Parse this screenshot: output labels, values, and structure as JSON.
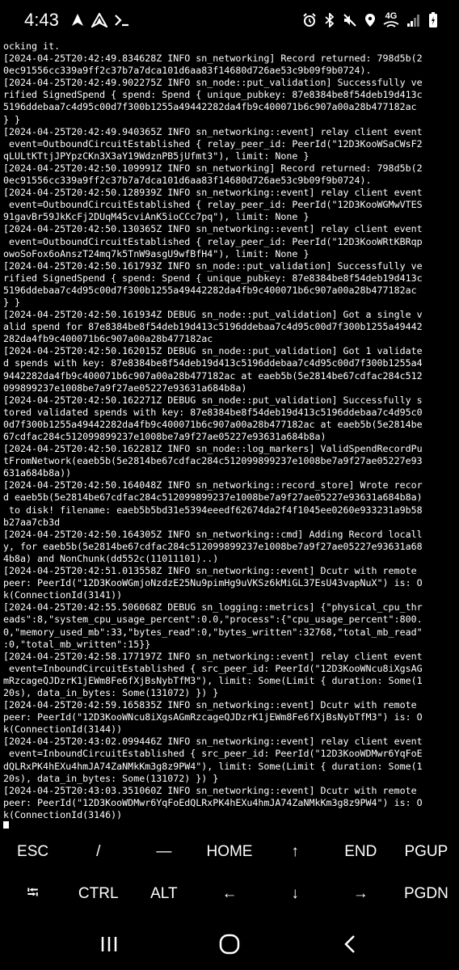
{
  "status_bar": {
    "time": "4:43",
    "network_label": "4G"
  },
  "terminal": {
    "lines": [
      "ocking it.",
      "[2024-04-25T20:42:49.834628Z INFO sn_networking] Record returned: 798d5b(2",
      "0ec91556cc339a9ff2c37b7a7dca101d6aa83f14680d726ae53c9b09f9b0724).",
      "[2024-04-25T20:42:49.902275Z INFO sn_node::put_validation] Successfully ve",
      "rified SignedSpend { spend: Spend { unique_pubkey: 87e8384be8f54deb19d413c",
      "5196ddebaa7c4d95c00d7f300b1255a49442282da4fb9c400071b6c907a00a28b477182ac",
      "} }",
      "[2024-04-25T20:42:49.940365Z INFO sn_networking::event] relay client event",
      " event=OutboundCircuitEstablished { relay_peer_id: PeerId(\"12D3KooWSaCWsF2",
      "qLULtKTtjJPYpzCKn3X3aY19WdznPB5jUfmt3\"), limit: None }",
      "[2024-04-25T20:42:50.109991Z INFO sn_networking] Record returned: 798d5b(2",
      "0ec91556cc339a9ff2c37b7a7dca101d6aa83f14680d726ae53c9b09f9b0724).",
      "[2024-04-25T20:42:50.128939Z INFO sn_networking::event] relay client event",
      " event=OutboundCircuitEstablished { relay_peer_id: PeerId(\"12D3KooWGMwVTES",
      "91gavBr59JkKcFj2DUqM45cviAnK5ioCCc7pq\"), limit: None }",
      "[2024-04-25T20:42:50.130365Z INFO sn_networking::event] relay client event",
      " event=OutboundCircuitEstablished { relay_peer_id: PeerId(\"12D3KooWRtKBRqp",
      "owoSoFox6oAnszT24mq7k5TnW9asgU9wfBfH4\"), limit: None }",
      "[2024-04-25T20:42:50.161793Z INFO sn_node::put_validation] Successfully ve",
      "rified SignedSpend { spend: Spend { unique_pubkey: 87e8384be8f54deb19d413c",
      "5196ddebaa7c4d95c00d7f300b1255a49442282da4fb9c400071b6c907a00a28b477182ac",
      "} }",
      "[2024-04-25T20:42:50.161934Z DEBUG sn_node::put_validation] Got a single v",
      "alid spend for 87e8384be8f54deb19d413c5196ddebaa7c4d95c00d7f300b1255a49442",
      "282da4fb9c400071b6c907a00a28b477182ac",
      "[2024-04-25T20:42:50.162015Z DEBUG sn_node::put_validation] Got 1 validate",
      "d spends with key: 87e8384be8f54deb19d413c5196ddebaa7c4d95c00d7f300b1255a4",
      "9442282da4fb9c400071b6c907a00a28b477182ac at eaeb5b(5e2814be67cdfac284c512",
      "099899237e1008be7a9f27ae05227e93631a684b8a)",
      "[2024-04-25T20:42:50.162271Z DEBUG sn_node::put_validation] Successfully s",
      "tored validated spends with key: 87e8384be8f54deb19d413c5196ddebaa7c4d95c0",
      "0d7f300b1255a49442282da4fb9c400071b6c907a00a28b477182ac at eaeb5b(5e2814be",
      "67cdfac284c512099899237e1008be7a9f27ae05227e93631a684b8a)",
      "[2024-04-25T20:42:50.162281Z INFO sn_node::log_markers] ValidSpendRecordPu",
      "tFromNetwork(eaeb5b(5e2814be67cdfac284c512099899237e1008be7a9f27ae05227e93",
      "631a684b8a))",
      "[2024-04-25T20:42:50.164048Z INFO sn_networking::record_store] Wrote recor",
      "d eaeb5b(5e2814be67cdfac284c512099899237e1008be7a9f27ae05227e93631a684b8a)",
      " to disk! filename: eaeb5b5bd31e5394eeedf62674da2f4f1045ee0260e933231a9b58",
      "b27aa7cb3d",
      "[2024-04-25T20:42:50.164305Z INFO sn_networking::cmd] Adding Record locall",
      "y, for eaeb5b(5e2814be67cdfac284c512099899237e1008be7a9f27ae05227e93631a68",
      "4b8a) and NonChunk(dd552c(11011101)..)",
      "[2024-04-25T20:42:51.013558Z INFO sn_networking::event] Dcutr with remote",
      "peer: PeerId(\"12D3KooWGmjoNzdzE25Nu9pimHg9uVKSz6kMiGL37EsU43vapNuX\") is: O",
      "k(ConnectionId(3141))",
      "[2024-04-25T20:42:55.506068Z DEBUG sn_logging::metrics] {\"physical_cpu_thr",
      "eads\":8,\"system_cpu_usage_percent\":0.0,\"process\":{\"cpu_usage_percent\":800.",
      "0,\"memory_used_mb\":33,\"bytes_read\":0,\"bytes_written\":32768,\"total_mb_read\"",
      ":0,\"total_mb_written\":15}}",
      "[2024-04-25T20:42:58.177197Z INFO sn_networking::event] relay client event",
      " event=InboundCircuitEstablished { src_peer_id: PeerId(\"12D3KooWNcu8iXgsAG",
      "mRzcageQJDzrK1jEWm8Fe6fXjBsNybTfM3\"), limit: Some(Limit { duration: Some(1",
      "20s), data_in_bytes: Some(131072) }) }",
      "[2024-04-25T20:42:59.165835Z INFO sn_networking::event] Dcutr with remote",
      "peer: PeerId(\"12D3KooWNcu8iXgsAGmRzcageQJDzrK1jEWm8Fe6fXjBsNybTfM3\") is: O",
      "k(ConnectionId(3144))",
      "[2024-04-25T20:43:02.099446Z INFO sn_networking::event] relay client event",
      " event=InboundCircuitEstablished { src_peer_id: PeerId(\"12D3KooWDMwr6YqFoE",
      "dQLRxPK4hEXu4hmJA74ZaNMkKm3g8z9PW4\"), limit: Some(Limit { duration: Some(1",
      "20s), data_in_bytes: Some(131072) }) }",
      "[2024-04-25T20:43:03.351060Z INFO sn_networking::event] Dcutr with remote",
      "peer: PeerId(\"12D3KooWDMwr6YqFoEdQLRxPK4hEXu4hmJA74ZaNMkKm3g8z9PW4\") is: O",
      "k(ConnectionId(3146))"
    ]
  },
  "extra_keys": {
    "row1": [
      "ESC",
      "/",
      "―",
      "HOME",
      "↑",
      "END",
      "PGUP"
    ],
    "row2": [
      "⭾",
      "CTRL",
      "ALT",
      "←",
      "↓",
      "→",
      "PGDN"
    ]
  },
  "icons": {
    "status_left": [
      "navigation-arrow-icon",
      "app-arrow-icon",
      "terminal-prompt-icon"
    ],
    "status_right": [
      "alarm-icon",
      "bluetooth-icon",
      "mute-icon",
      "location-icon",
      "wifi-icon",
      "signal-icon",
      "battery-icon"
    ],
    "nav": [
      "recents-icon",
      "home-icon",
      "back-icon"
    ]
  }
}
